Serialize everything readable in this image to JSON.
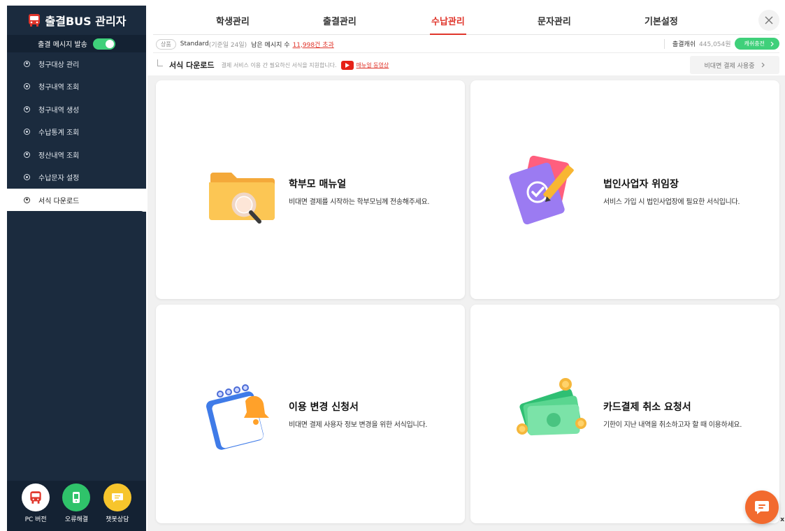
{
  "sidebar": {
    "brand_title": "출결BUS 관리자",
    "message_toggle_label": "출결 메시지 발송",
    "message_toggle_on": true,
    "items": [
      {
        "label": "청구대상 관리"
      },
      {
        "label": "청구내역 조회"
      },
      {
        "label": "청구내역 생성"
      },
      {
        "label": "수납통계 조회"
      },
      {
        "label": "정산내역 조회"
      },
      {
        "label": "수납문자 설정"
      },
      {
        "label": "서식 다운로드"
      }
    ],
    "active_item": "서식 다운로드",
    "quick_links": [
      {
        "label": "PC 버전",
        "icon": "bus-icon",
        "color": "#ffffff"
      },
      {
        "label": "오류해결",
        "icon": "phone-fix-icon",
        "color": "#2fc36a"
      },
      {
        "label": "챗봇상담",
        "icon": "chat-bubble-icon",
        "color": "#f7c52c"
      }
    ]
  },
  "topnav": {
    "tabs": [
      {
        "label": "학생관리"
      },
      {
        "label": "출결관리"
      },
      {
        "label": "수납관리"
      },
      {
        "label": "문자관리"
      },
      {
        "label": "기본설정"
      }
    ],
    "active_tab": "수납관리",
    "close_icon": "close-icon"
  },
  "planbar": {
    "badge": "상품",
    "plan_name": "Standard",
    "plan_note": "(기준일 24일)",
    "remaining_label": "남은 메시지 수",
    "remaining_value": "11,998건 초과",
    "cash_label": "출결캐쉬",
    "cash_value": "445,054원",
    "cash_button": "캐쉬충전"
  },
  "section": {
    "title": "서식 다운로드",
    "description": "결제 서비스 이용 간 필요하신 서식을 지원합니다.",
    "video_link": "매뉴얼 동영상",
    "nonface_button": "비대면 결제 사용중"
  },
  "cards": [
    {
      "title": "학부모 매뉴얼",
      "desc": "비대면 결제를 시작하는 학부모님께 전송해주세요.",
      "icon": "folder-search-icon"
    },
    {
      "title": "법인사업자 위임장",
      "desc": "서비스 가입 시 법인사업장에 필요한 서식입니다.",
      "icon": "document-pencil-icon"
    },
    {
      "title": "이용 변경 신청서",
      "desc": "비대면 결제 사용자 정보 변경을 위한 서식입니다.",
      "icon": "notepad-bell-icon"
    },
    {
      "title": "카드결제 취소 요청서",
      "desc": "기한이 지난 내역을 취소하고자 할 때 이용하세요.",
      "icon": "money-coins-icon"
    }
  ],
  "colors": {
    "sidebar_bg": "#1b2b3e",
    "accent_red": "#e0352b",
    "accent_green": "#3fd07a",
    "chat_orange": "#f26a2e"
  },
  "misc": {
    "corner_x": "x"
  }
}
